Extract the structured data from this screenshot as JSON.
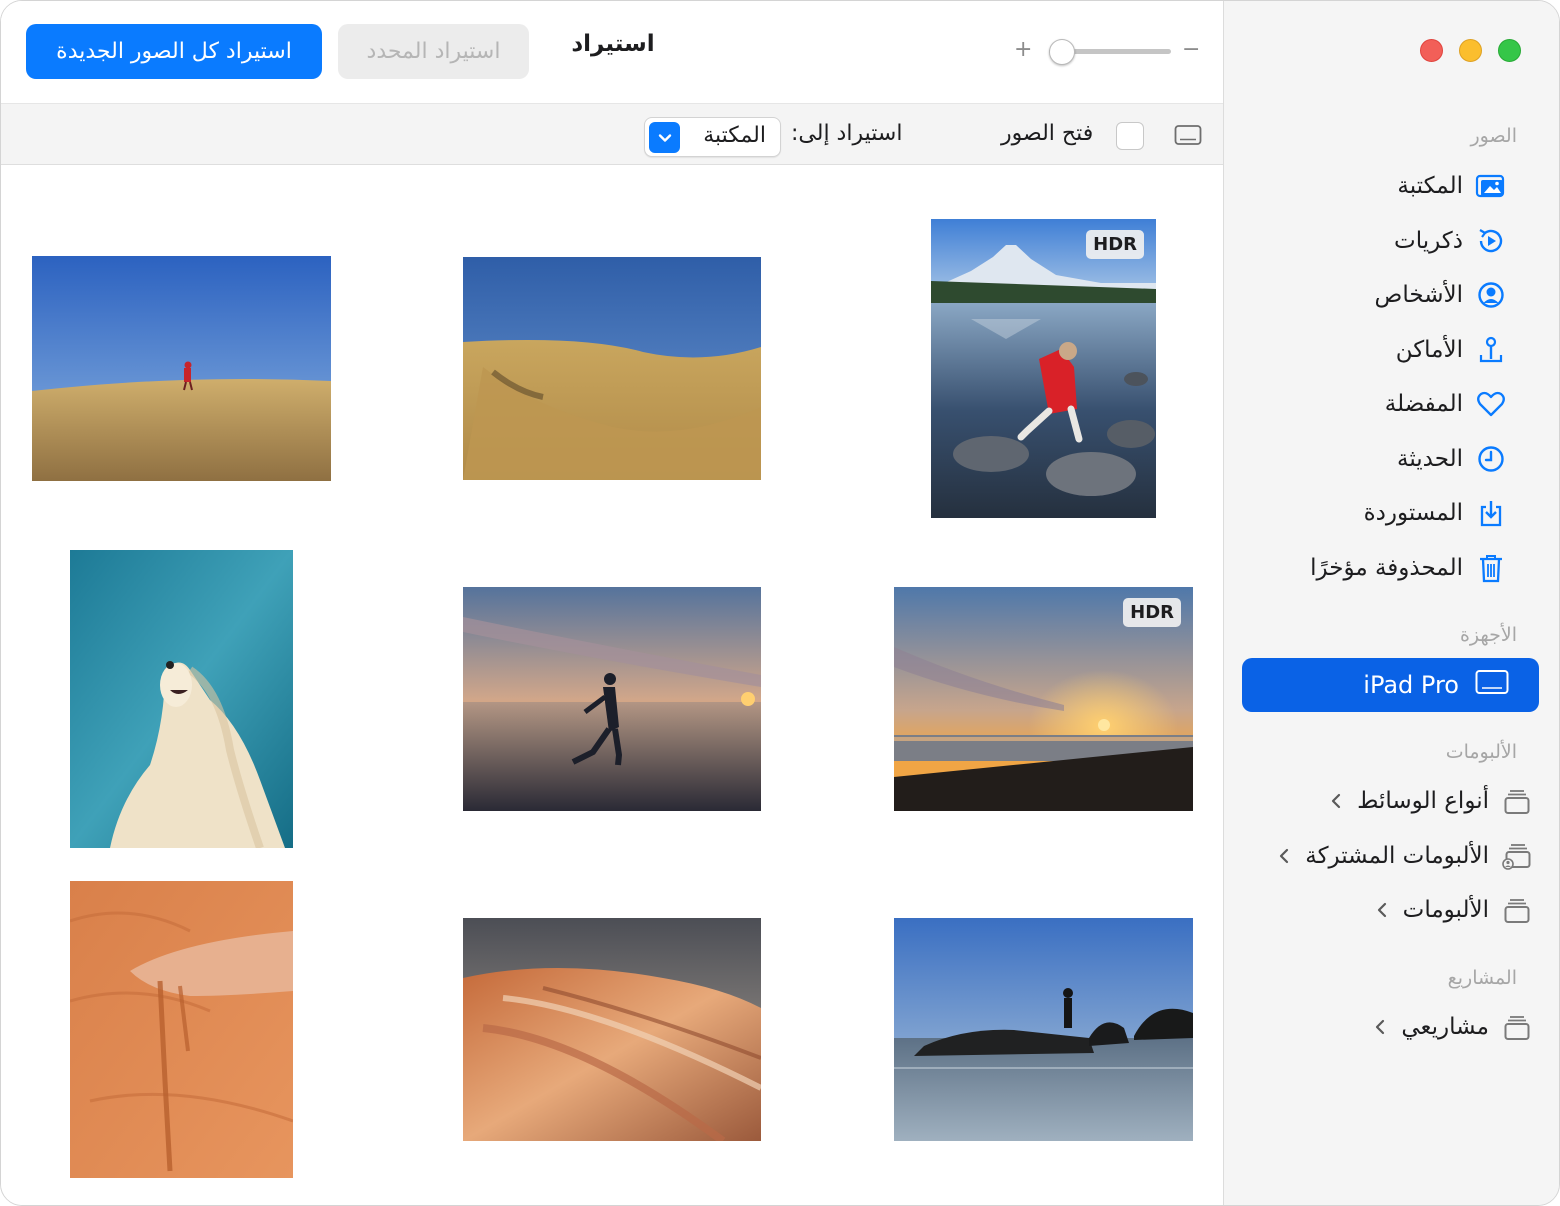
{
  "toolbar": {
    "import_all_label": "استيراد كل الصور الجديدة",
    "import_selected_label": "استيراد المحدد",
    "title": "استيراد",
    "zoom_in_glyph": "+",
    "zoom_out_glyph": "−",
    "zoom_level": 0.07
  },
  "options": {
    "open_photos_label": "فتح الصور",
    "open_photos_checked": false,
    "import_to_label": "استيراد إلى:",
    "import_to_value": "المكتبة"
  },
  "sidebar": {
    "photos_header": "الصور",
    "items": [
      {
        "label": "المكتبة",
        "icon": "library-icon"
      },
      {
        "label": "ذكريات",
        "icon": "memories-icon"
      },
      {
        "label": "الأشخاص",
        "icon": "people-icon"
      },
      {
        "label": "الأماكن",
        "icon": "places-icon"
      },
      {
        "label": "المفضلة",
        "icon": "heart-icon"
      },
      {
        "label": "الحديثة",
        "icon": "clock-icon"
      },
      {
        "label": "المستوردة",
        "icon": "import-icon"
      },
      {
        "label": "المحذوفة مؤخرًا",
        "icon": "trash-icon"
      }
    ],
    "devices_header": "الأجهزة",
    "device": {
      "label": "iPad Pro",
      "icon": "ipad-icon"
    },
    "albums_header": "الألبومات",
    "album_items": [
      {
        "label": "أنواع الوسائط",
        "icon": "folder-icon"
      },
      {
        "label": "الألبومات المشتركة",
        "icon": "shared-folder-icon"
      },
      {
        "label": "الألبومات",
        "icon": "folder-icon"
      }
    ],
    "projects_header": "المشاريع",
    "project_items": [
      {
        "label": "مشاريعي",
        "icon": "folder-icon"
      }
    ]
  },
  "photos": {
    "hdr_badge": "HDR",
    "items": [
      {
        "subject": "mountain-lake-jump",
        "hdr": true
      },
      {
        "subject": "golden-hillside",
        "hdr": false
      },
      {
        "subject": "person-on-grassy-hill",
        "hdr": false
      },
      {
        "subject": "beach-sunset",
        "hdr": true
      },
      {
        "subject": "runner-on-beach-sunset",
        "hdr": false
      },
      {
        "subject": "afghan-hound-dog",
        "hdr": false
      },
      {
        "subject": "person-on-sea-rock",
        "hdr": false
      },
      {
        "subject": "sandstone-wave",
        "hdr": false
      },
      {
        "subject": "hand-pouring-sand",
        "hdr": false
      }
    ]
  },
  "colors": {
    "accent": "#0a7bff",
    "selection": "#0a62e6",
    "sidebar_bg": "#f5f5f5",
    "close": "#f25f58",
    "minimize": "#fbbe2e",
    "maximize": "#35c648"
  }
}
